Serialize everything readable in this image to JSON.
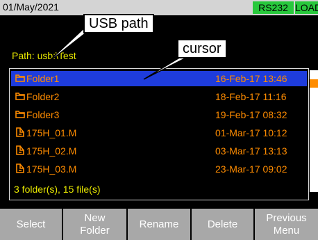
{
  "status_bar": {
    "date": "01/May/2021",
    "rs232": "RS232",
    "load": "LOAD",
    "badge_color": "#28c83c"
  },
  "path_label": "Path: usb:\\Test",
  "file_list": {
    "rows": [
      {
        "icon": "folder-icon",
        "name": "Folder1",
        "date": "16-Feb-17 13:46",
        "selected": true
      },
      {
        "icon": "folder-icon",
        "name": "Folder2",
        "date": "18-Feb-17 11:16"
      },
      {
        "icon": "folder-icon",
        "name": "Folder3",
        "date": "19-Feb-17 08:32"
      },
      {
        "icon": "file-icon",
        "name": "175H_01.M",
        "date": "01-Mar-17 10:12"
      },
      {
        "icon": "file-icon",
        "name": "175H_02.M",
        "date": "03-Mar-17 13:13"
      },
      {
        "icon": "file-icon",
        "name": "175H_03.M",
        "date": "23-Mar-17 09:02"
      }
    ],
    "summary": "3 folder(s), 15 file(s)",
    "text_color": "#ff8c00",
    "selection_color": "#1e3cdc"
  },
  "function_keys": [
    {
      "line1": "Select",
      "line2": ""
    },
    {
      "line1": "New",
      "line2": "Folder"
    },
    {
      "line1": "Rename",
      "line2": ""
    },
    {
      "line1": "Delete",
      "line2": ""
    },
    {
      "line1": "Previous",
      "line2": "Menu"
    }
  ],
  "annotations": {
    "usb_path": "USB path",
    "cursor": "cursor"
  }
}
